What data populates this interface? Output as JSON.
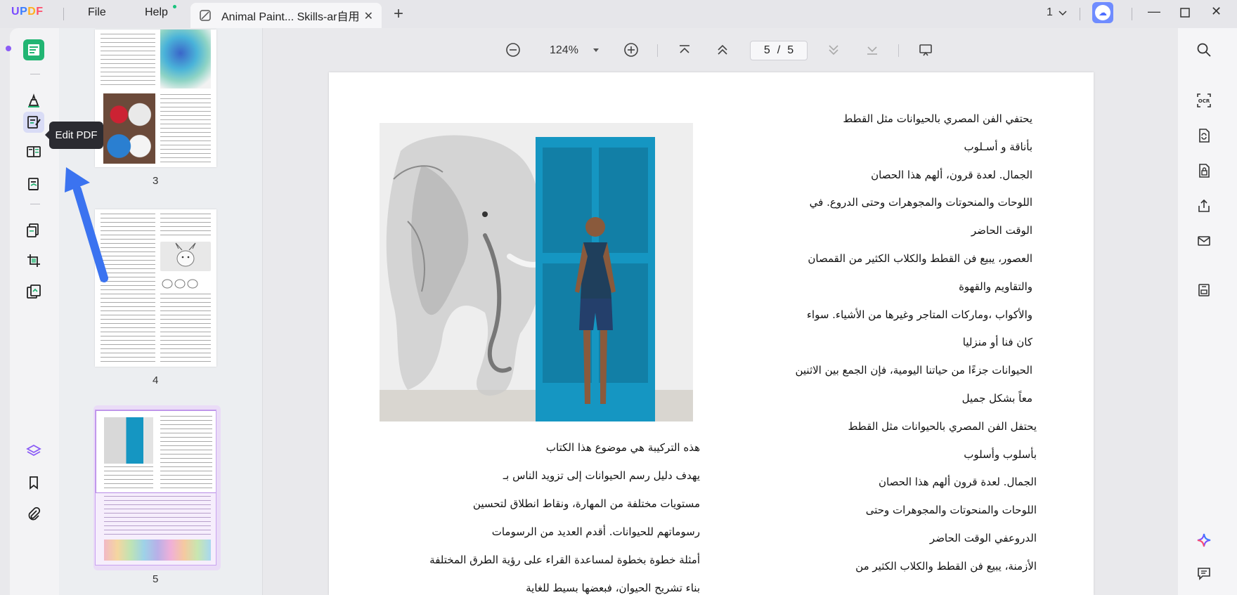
{
  "app": {
    "logo": "UPDF",
    "menu": {
      "file": "File",
      "help": "Help"
    },
    "tab_title": "Animal Paint... Skills-ar自用",
    "page_count_badge": "1"
  },
  "tooltip": {
    "text": "Edit PDF"
  },
  "thumbnails": [
    {
      "label": "3"
    },
    {
      "label": "4"
    },
    {
      "label": "5"
    }
  ],
  "toolbar": {
    "zoom": "124%",
    "current_page": "5",
    "separator": "/",
    "total_pages": "5"
  },
  "right_column": [
    "يحتفي الفن المصري بالحيوانات مثل القطط",
    "بأناقة و أسـلوب",
    "الجمال. لعدة قرون، ألهم هذا الحصان",
    "اللوحات والمنحوتات والمجوهرات وحتى الدروع. في",
    "الوقت الحاضر",
    "العصور، يبيع فن القطط والكلاب الكثير من القمصان",
    "والتقاويم والقهوة",
    "والأكواب ،وماركات المتاجر وغيرها من الأشياء. سواء",
    "كان فنا أو منزليا",
    "الحيوانات جزءًا من حياتنا اليومية، فإن الجمع بين الاثنين",
    "معاً بشكل جميل",
    "يحتفل الفن المصري بالحيوانات مثل القطط",
    "بأسلوب وأسلوب",
    "الجمال. لعدة قرون ألهم هذا الحصان",
    "اللوحات والمنحوتات والمجوهرات وحتى",
    "الدروعفي الوقت الحاضر",
    "الأزمنة، يبيع فن القطط والكلاب الكثير من"
  ],
  "left_column": [
    "هذه التركيبة هي موضوع هذا الكتاب",
    "يهدف دليل رسم الحيوانات إلى تزويد الناس بـ",
    "مستويات مختلفة من المهارة، ونقاط انطلاق لتحسين",
    "رسوماتهم للحيوانات. أقدم العديد من الرسومات",
    "أمثلة خطوة بخطوة لمساعدة القراء على رؤية الطرق المختلفة",
    "بناء تشريح الحيوان، فبعضها بسيط للغاية"
  ],
  "colors": {
    "accent_green": "#22b573",
    "accent_purple": "#8b5cf6",
    "arrow_blue": "#3b73f0",
    "door_blue": "#1596c2"
  }
}
